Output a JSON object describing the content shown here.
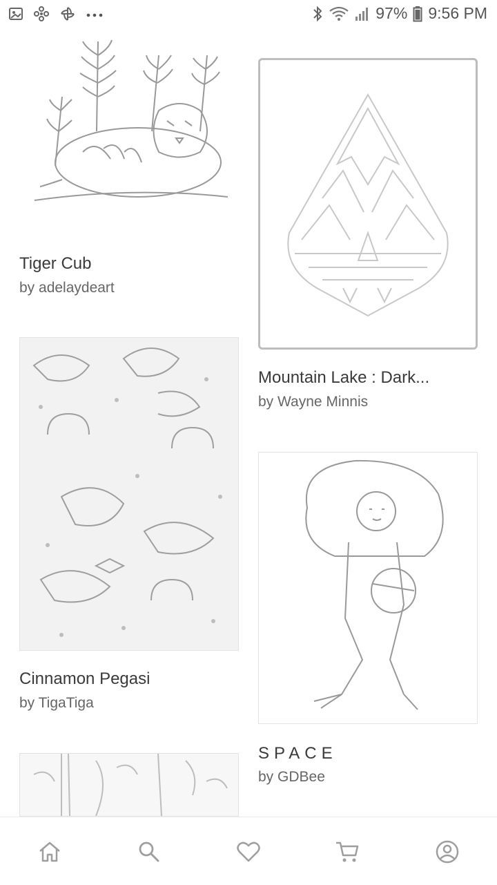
{
  "status_bar": {
    "battery": "97%",
    "time": "9:56 PM",
    "left_icons": [
      "gallery-icon",
      "pinwheel-icon",
      "fan-icon",
      "more-dots-icon"
    ],
    "right_icons": [
      "bluetooth-icon",
      "wifi-icon",
      "signal-icon",
      "battery-icon"
    ]
  },
  "cards": [
    {
      "title": "Tiger Cub",
      "author": "by adelaydeart",
      "art": "tiger-illustration"
    },
    {
      "title": "Mountain Lake : Dark...",
      "author": "by Wayne Minnis",
      "art": "mountain-lake-illustration"
    },
    {
      "title": "Cinnamon Pegasi",
      "author": "by TigaTiga",
      "art": "pegasi-pattern-illustration"
    },
    {
      "title": "SPACE",
      "author": "by GDBee",
      "art": "astronaut-girl-illustration"
    },
    {
      "title": "",
      "author": "",
      "art": "partial-forest-illustration"
    }
  ],
  "bottom_nav": {
    "items": [
      "home-icon",
      "search-icon",
      "heart-icon",
      "cart-icon",
      "profile-icon"
    ],
    "active_color": "#9e9e9e"
  }
}
